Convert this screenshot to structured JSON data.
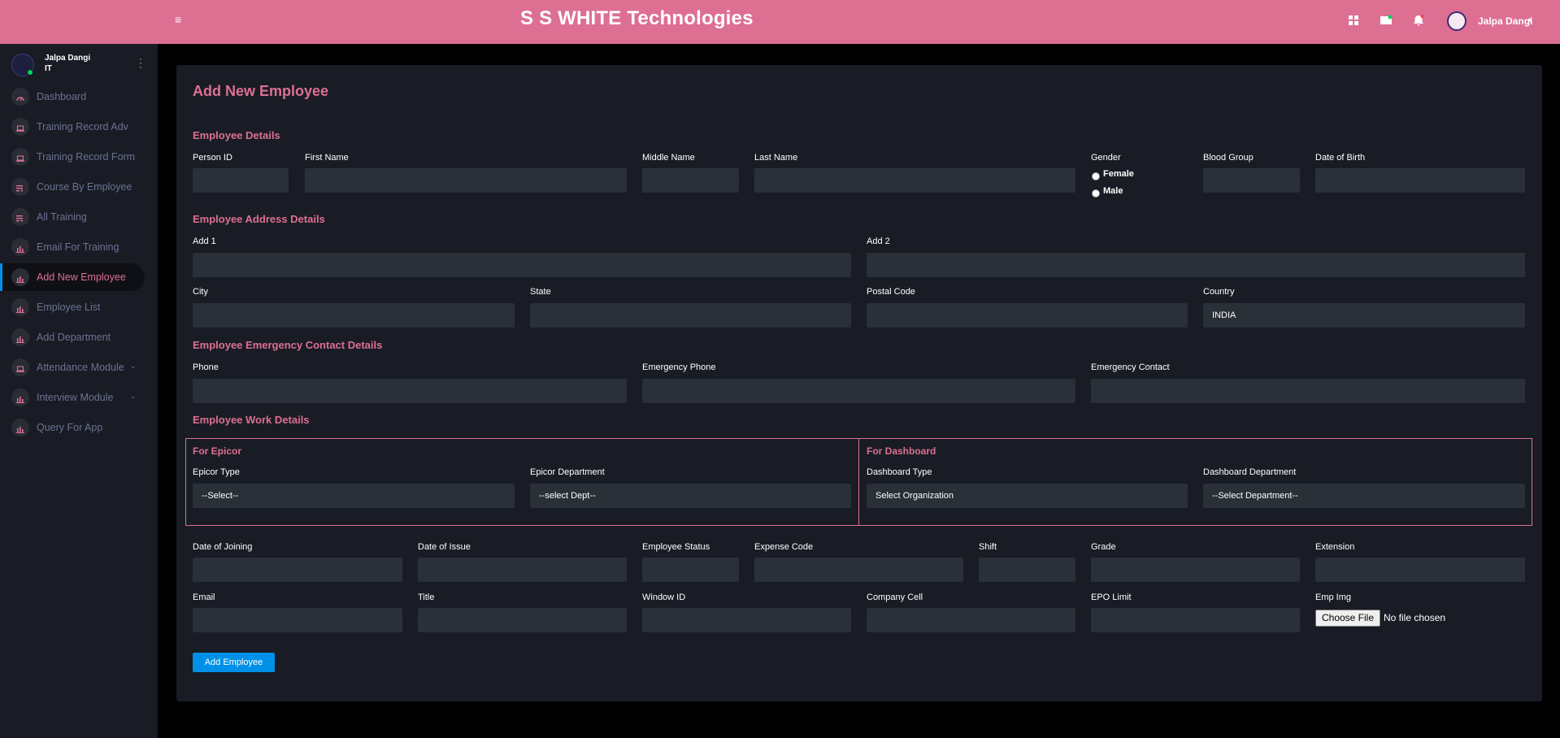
{
  "header": {
    "brand": "S S WHITE Technologies",
    "user_name": "Jalpa Dangi",
    "icons": [
      "menu-icon",
      "grid-icon",
      "mail-icon",
      "bell-icon"
    ]
  },
  "sidebar": {
    "user": {
      "name": "Jalpa Dangi",
      "dept": "IT"
    },
    "items": [
      {
        "label": "Dashboard",
        "icon": "speedometer-icon"
      },
      {
        "label": "Training Record Adv",
        "icon": "laptop-icon"
      },
      {
        "label": "Training Record Form",
        "icon": "laptop-icon"
      },
      {
        "label": "Course By Employee",
        "icon": "playlist-icon"
      },
      {
        "label": "All Training",
        "icon": "playlist-icon"
      },
      {
        "label": "Email For Training",
        "icon": "chart-icon"
      },
      {
        "label": "Add New Employee",
        "icon": "chart-icon"
      },
      {
        "label": "Employee List",
        "icon": "chart-icon"
      },
      {
        "label": "Add Department",
        "icon": "chart-icon"
      },
      {
        "label": "Attendance Module",
        "icon": "laptop-icon"
      },
      {
        "label": "Interview Module",
        "icon": "chart-icon"
      },
      {
        "label": "Query For App",
        "icon": "chart-icon"
      }
    ],
    "active_index": 6
  },
  "form": {
    "title": "Add New Employee",
    "sections": {
      "details": "Employee Details",
      "address": "Employee Address Details",
      "emergency": "Employee Emergency Contact Details",
      "work": "Employee Work Details"
    },
    "labels": {
      "person_id": "Person ID",
      "first_name": "First Name",
      "middle_name": "Middle Name",
      "last_name": "Last Name",
      "gender": "Gender",
      "female": "Female",
      "male": "Male",
      "blood_group": "Blood Group",
      "dob": "Date of Birth",
      "add1": "Add 1",
      "add2": "Add 2",
      "city": "City",
      "state": "State",
      "postal": "Postal Code",
      "country": "Country",
      "phone": "Phone",
      "emergency_phone": "Emergency Phone",
      "emergency_contact": "Emergency Contact",
      "for_epicor": "For Epicor",
      "epicor_type": "Epicor Type",
      "epicor_dept": "Epicor Department",
      "for_dashboard": "For Dashboard",
      "dashboard_type": "Dashboard Type",
      "dashboard_dept": "Dashboard Department",
      "doj": "Date of Joining",
      "doi": "Date of Issue",
      "emp_status": "Employee Status",
      "expense_code": "Expense Code",
      "shift": "Shift",
      "grade": "Grade",
      "extension": "Extension",
      "email": "Email",
      "title": "Title",
      "window_id": "Window ID",
      "company_cell": "Company Cell",
      "epo_limit": "EPO Limit",
      "emp_img": "Emp Img"
    },
    "values": {
      "country": "INDIA",
      "epicor_type": "--Select--",
      "epicor_dept": "--select Dept--",
      "dashboard_type": "Select Organization",
      "dashboard_dept": "--Select Department--"
    },
    "file": {
      "button": "Choose File",
      "status": "No file chosen"
    },
    "submit": "Add Employee"
  },
  "colors": {
    "accent": "#dd6f93",
    "primary": "#0090e7",
    "panel": "#191c24",
    "input": "#2a3038"
  }
}
